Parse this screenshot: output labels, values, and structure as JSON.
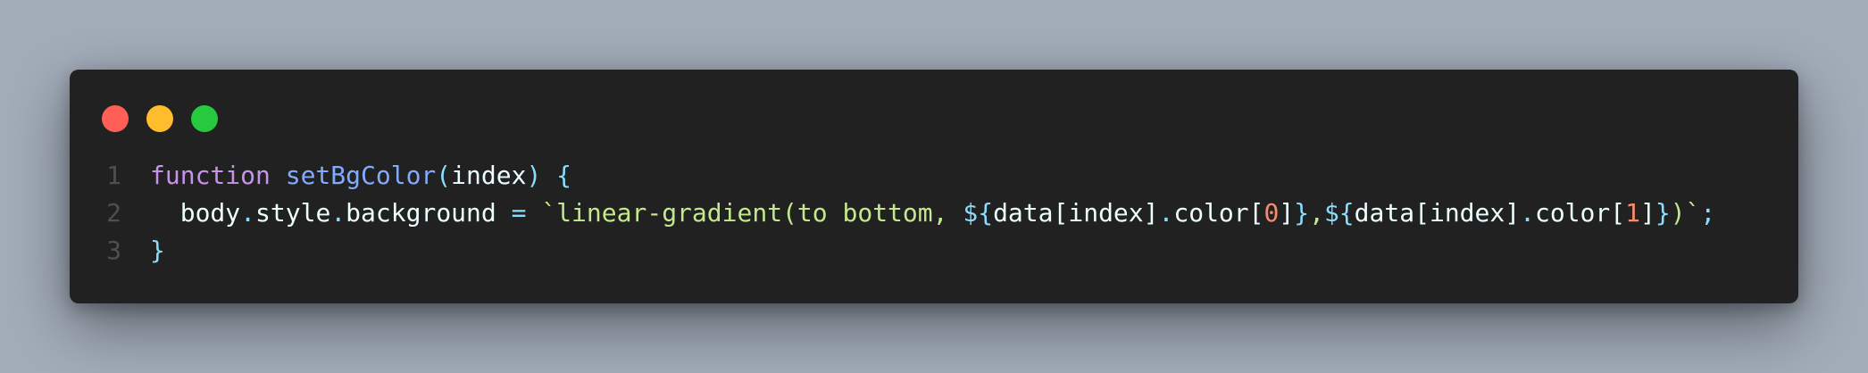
{
  "window": {
    "controls": [
      {
        "name": "close",
        "color": "#ff5f56"
      },
      {
        "name": "minimize",
        "color": "#ffbd2e"
      },
      {
        "name": "maximize",
        "color": "#27c93f"
      }
    ]
  },
  "code": {
    "lines": [
      {
        "number": "1",
        "tokens": [
          {
            "text": "function",
            "kind": "kw"
          },
          {
            "text": " ",
            "kind": "plain"
          },
          {
            "text": "setBgColor",
            "kind": "fn"
          },
          {
            "text": "(",
            "kind": "punc"
          },
          {
            "text": "index",
            "kind": "plain"
          },
          {
            "text": ")",
            "kind": "punc"
          },
          {
            "text": " ",
            "kind": "plain"
          },
          {
            "text": "{",
            "kind": "punc"
          }
        ]
      },
      {
        "number": "2",
        "tokens": [
          {
            "text": "  body",
            "kind": "plain"
          },
          {
            "text": ".",
            "kind": "punc"
          },
          {
            "text": "style",
            "kind": "plain"
          },
          {
            "text": ".",
            "kind": "punc"
          },
          {
            "text": "background",
            "kind": "plain"
          },
          {
            "text": " ",
            "kind": "plain"
          },
          {
            "text": "=",
            "kind": "punc"
          },
          {
            "text": " ",
            "kind": "plain"
          },
          {
            "text": "`linear-gradient(to bottom, ",
            "kind": "str"
          },
          {
            "text": "${",
            "kind": "punc"
          },
          {
            "text": "data[index]",
            "kind": "plain"
          },
          {
            "text": ".",
            "kind": "punc"
          },
          {
            "text": "color[",
            "kind": "plain"
          },
          {
            "text": "0",
            "kind": "num"
          },
          {
            "text": "]",
            "kind": "plain"
          },
          {
            "text": "}",
            "kind": "punc"
          },
          {
            "text": ",",
            "kind": "str"
          },
          {
            "text": "${",
            "kind": "punc"
          },
          {
            "text": "data[index]",
            "kind": "plain"
          },
          {
            "text": ".",
            "kind": "punc"
          },
          {
            "text": "color[",
            "kind": "plain"
          },
          {
            "text": "1",
            "kind": "num"
          },
          {
            "text": "]",
            "kind": "plain"
          },
          {
            "text": "}",
            "kind": "punc"
          },
          {
            "text": ")`",
            "kind": "str"
          },
          {
            "text": ";",
            "kind": "punc"
          }
        ]
      },
      {
        "number": "3",
        "tokens": [
          {
            "text": "}",
            "kind": "punc"
          }
        ]
      }
    ]
  }
}
